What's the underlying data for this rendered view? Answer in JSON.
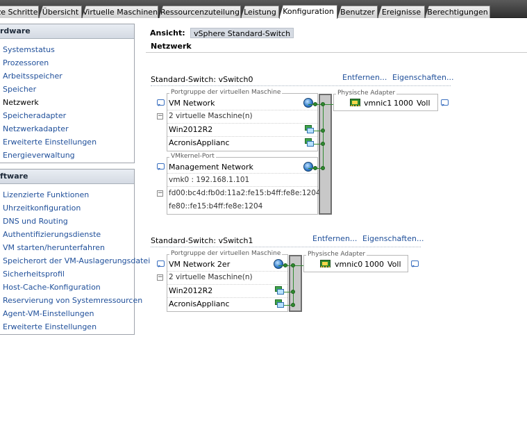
{
  "tabs": [
    {
      "label": "ze Schritte"
    },
    {
      "label": "Übersicht"
    },
    {
      "label": "Virtuelle Maschinen"
    },
    {
      "label": "Ressourcenzuteilung"
    },
    {
      "label": "Leistung"
    },
    {
      "label": "Konfiguration",
      "active": true
    },
    {
      "label": "Benutzer"
    },
    {
      "label": "Ereignisse"
    },
    {
      "label": "Berechtigungen"
    }
  ],
  "hardware": {
    "header": "rdware",
    "items": [
      "Systemstatus",
      "Prozessoren",
      "Arbeitsspeicher",
      "Speicher",
      "Netzwerk",
      "Speicheradapter",
      "Netzwerkadapter",
      "Erweiterte Einstellungen",
      "Energieverwaltung"
    ],
    "selected": "Netzwerk"
  },
  "software": {
    "header": "ftware",
    "items": [
      "Lizenzierte Funktionen",
      "Uhrzeitkonfiguration",
      "DNS und Routing",
      "Authentifizierungsdienste",
      "VM starten/herunterfahren",
      "Speicherort der VM-Auslagerungsdatei",
      "Sicherheitsprofil",
      "Host-Cache-Konfiguration",
      "Reservierung von Systemressourcen",
      "Agent-VM-Einstellungen",
      "Erweiterte Einstellungen"
    ]
  },
  "view": {
    "label": "Ansicht:",
    "value": "vSphere Standard-Switch",
    "section_title": "Netzwerk"
  },
  "switches": [
    {
      "title": "Standard-Switch: vSwitch0",
      "remove_link": "Entfernen...",
      "properties_link": "Eigenschaften...",
      "vm_portgroup_caption": "Portgruppe der virtuellen Maschine",
      "portgroup_name": "VM Network",
      "vm_count": "2 virtuelle Maschine(n)",
      "vms": [
        "Win2012R2",
        "AcronisApplianc"
      ],
      "vmkernel_caption": "VMkernel-Port",
      "vmkernel_name": "Management Network",
      "vmkernel_ip": "vmk0 : 192.168.1.101",
      "vmkernel_ipv6": [
        "fd00:bc4d:fb0d:11a2:fe15:b4ff:fe8e:1204",
        "fe80::fe15:b4ff:fe8e:1204"
      ],
      "adapter_caption": "Physische Adapter",
      "adapter": {
        "name": "vmnic1",
        "speed": "1000",
        "duplex": "Voll"
      }
    },
    {
      "title": "Standard-Switch: vSwitch1",
      "remove_link": "Entfernen...",
      "properties_link": "Eigenschaften...",
      "vm_portgroup_caption": "Portgruppe der virtuellen Maschine",
      "portgroup_name": "VM Network 2er",
      "vm_count": "2 virtuelle Maschine(n)",
      "vms": [
        "Win2012R2",
        "AcronisApplianc"
      ],
      "adapter_caption": "Physische Adapter",
      "adapter": {
        "name": "vmnic0",
        "speed": "1000",
        "duplex": "Voll"
      }
    }
  ],
  "colors": {
    "link": "#1f4f9a",
    "port_green": "#2f8a2f",
    "tab_bar": "#3d3d3d"
  }
}
